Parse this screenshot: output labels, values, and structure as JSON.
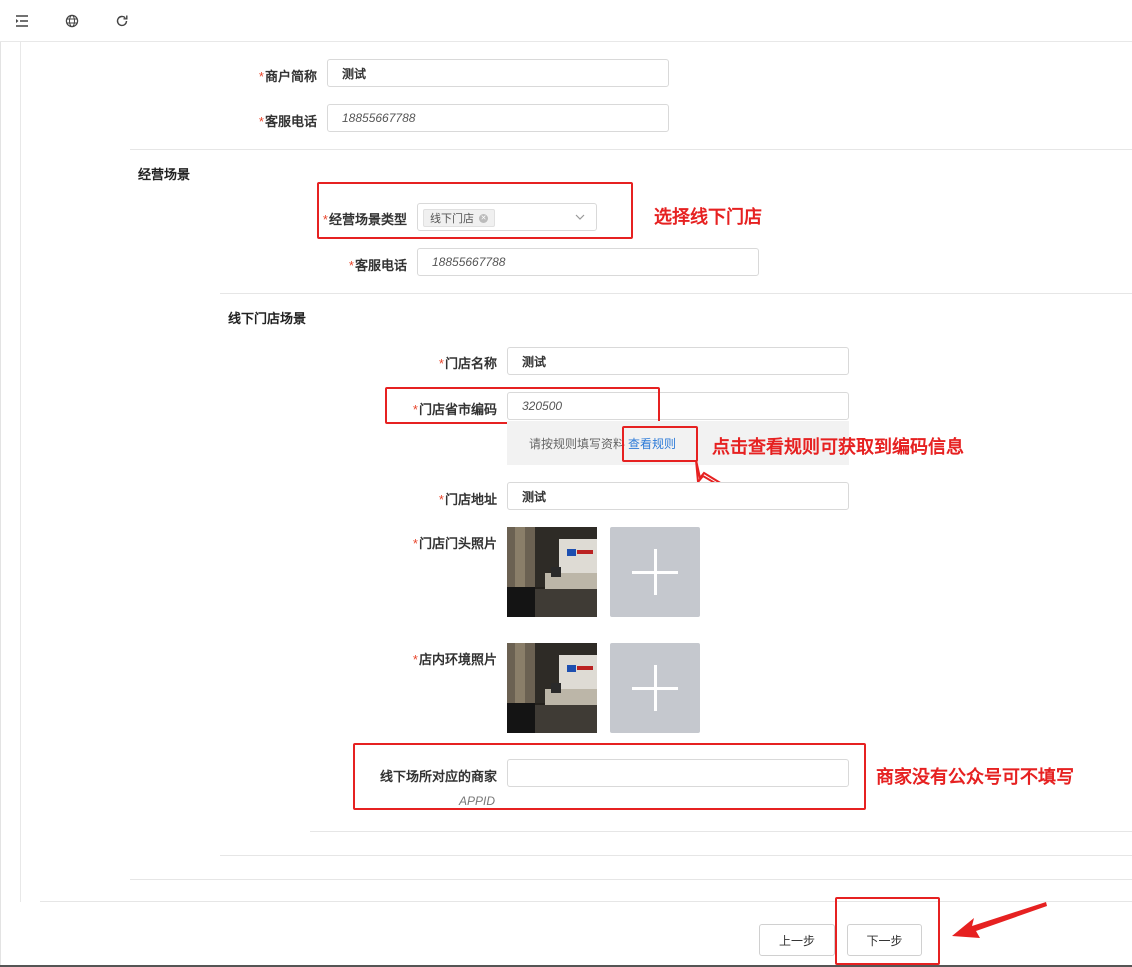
{
  "toolbar": {
    "menu_icon": "menu-fold-icon",
    "globe_icon": "globe-icon",
    "refresh_icon": "refresh-icon"
  },
  "merchant": {
    "short_name_label": "商户简称",
    "short_name_value": "测试",
    "service_phone_label": "客服电话",
    "service_phone_value": "18855667788"
  },
  "scene": {
    "section_title": "经营场景",
    "type_label": "经营场景类型",
    "type_tag": "线下门店",
    "service_phone_label": "客服电话",
    "service_phone_value": "18855667788"
  },
  "store": {
    "section_title": "线下门店场景",
    "name_label": "门店名称",
    "name_value": "测试",
    "code_label": "门店省市编码",
    "code_value": "320500",
    "hint_text": "请按规则填写资料",
    "hint_link": "查看规则",
    "address_label": "门店地址",
    "address_value": "测试",
    "front_photo_label": "门店门头照片",
    "env_photo_label": "店内环境照片",
    "appid_label": "线下场所对应的商家",
    "appid_sub": "APPID",
    "appid_value": ""
  },
  "annotations": {
    "select_store": "选择线下门店",
    "view_rules": "点击查看规则可获取到编码信息",
    "no_official": "商家没有公众号可不填写"
  },
  "footer": {
    "prev_label": "上一步",
    "next_label": "下一步"
  },
  "colors": {
    "annotation_red": "#e62121",
    "link_blue": "#2d7bd8",
    "required_star": "#e8452b"
  }
}
